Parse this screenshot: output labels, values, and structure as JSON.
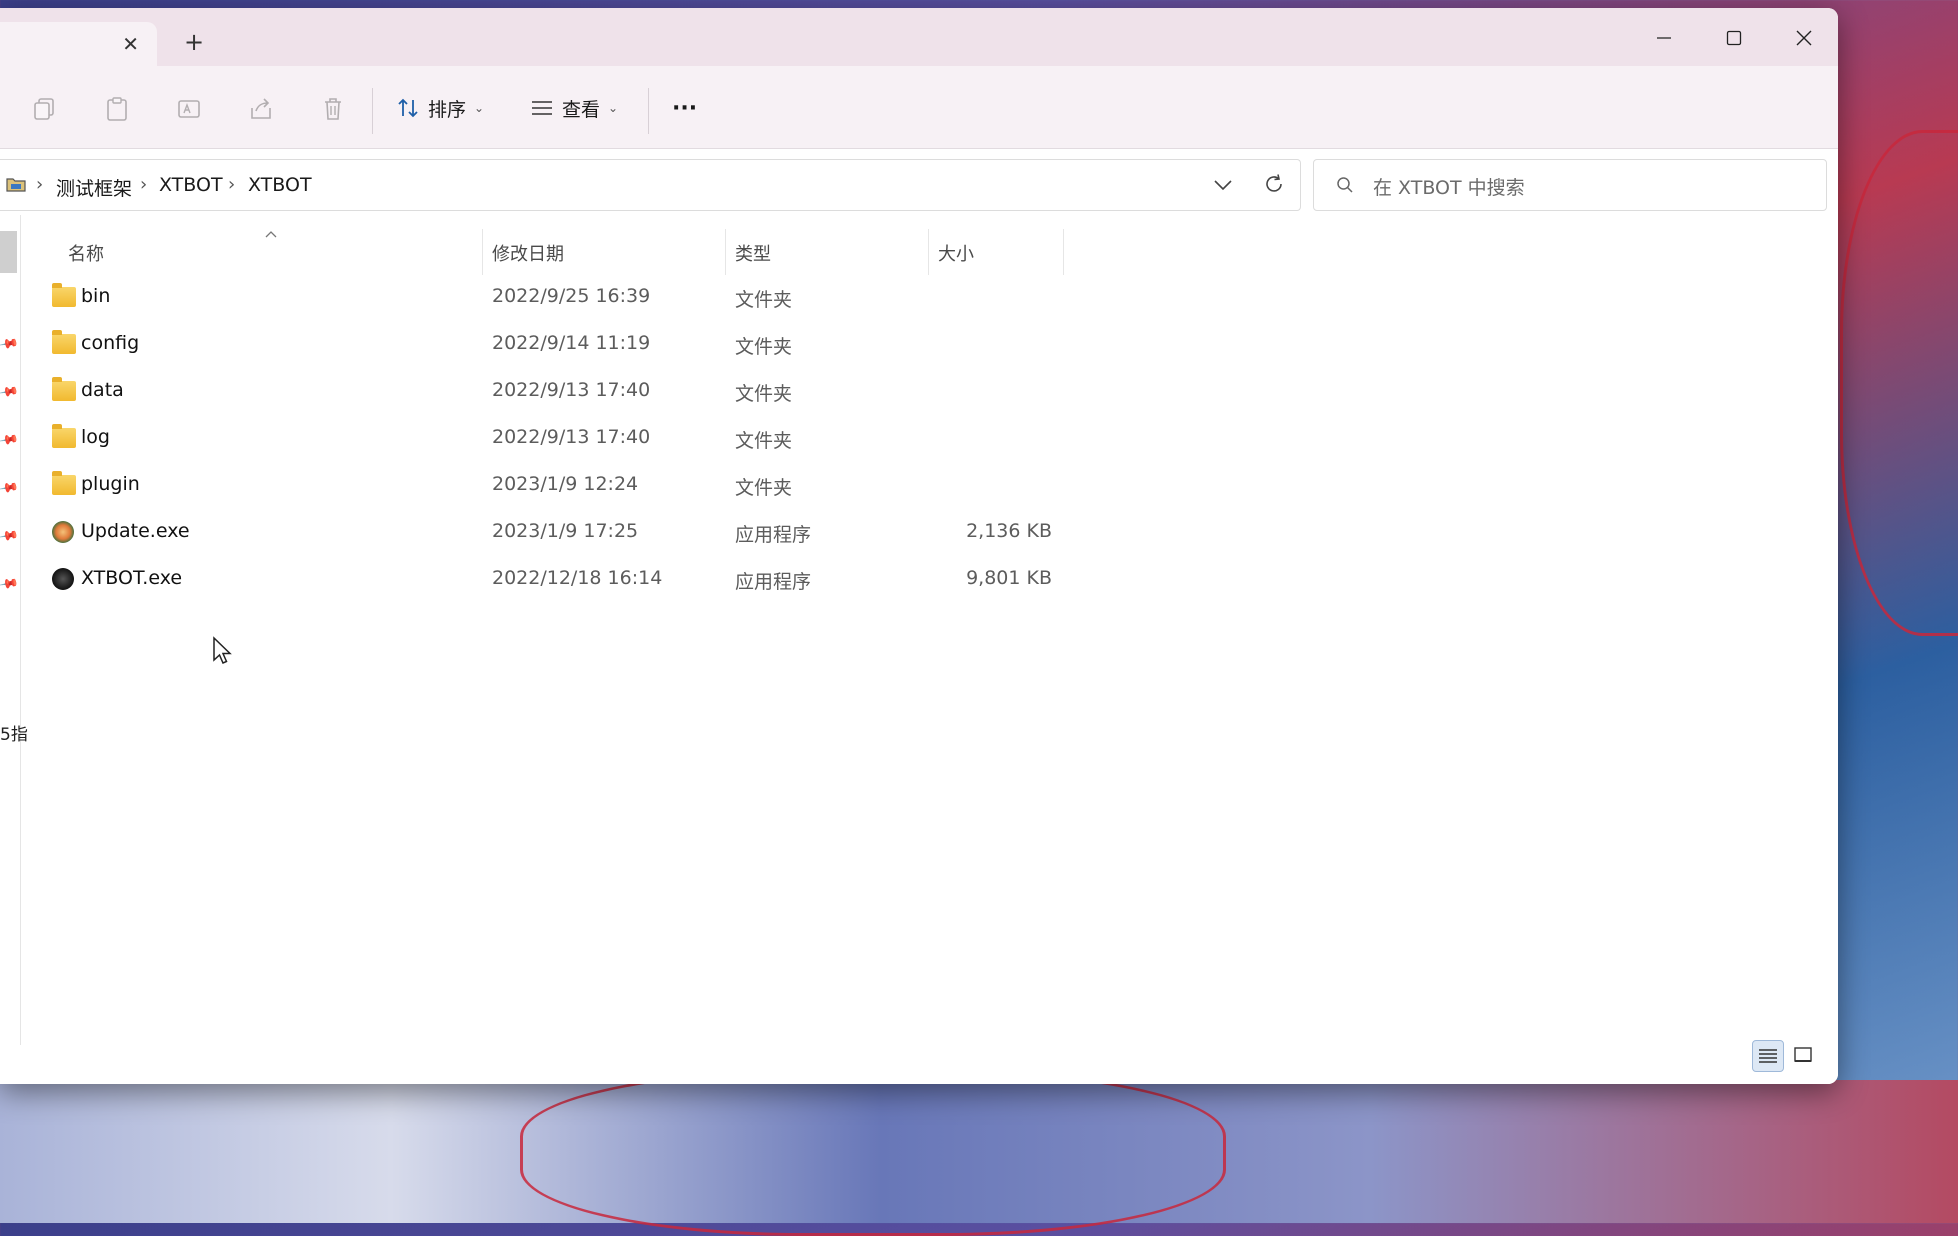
{
  "window": {
    "tab_close_glyph": "✕",
    "new_tab_glyph": "+"
  },
  "toolbar": {
    "sort_label": "排序",
    "view_label": "查看",
    "more_glyph": "···"
  },
  "breadcrumb": {
    "items": [
      "测试框架",
      "XTBOT",
      "XTBOT"
    ],
    "separator": "›"
  },
  "search": {
    "placeholder": "在 XTBOT 中搜索"
  },
  "columns": {
    "name": "名称",
    "date": "修改日期",
    "type": "类型",
    "size": "大小"
  },
  "files": [
    {
      "name": "bin",
      "date": "2022/9/25 16:39",
      "type": "文件夹",
      "size": "",
      "icon": "folder-icon"
    },
    {
      "name": "config",
      "date": "2022/9/14 11:19",
      "type": "文件夹",
      "size": "",
      "icon": "folder-icon"
    },
    {
      "name": "data",
      "date": "2022/9/13 17:40",
      "type": "文件夹",
      "size": "",
      "icon": "folder-icon"
    },
    {
      "name": "log",
      "date": "2022/9/13 17:40",
      "type": "文件夹",
      "size": "",
      "icon": "folder-icon"
    },
    {
      "name": "plugin",
      "date": "2023/1/9 12:24",
      "type": "文件夹",
      "size": "",
      "icon": "folder-icon"
    },
    {
      "name": "Update.exe",
      "date": "2023/1/9 17:25",
      "type": "应用程序",
      "size": "2,136 KB",
      "icon": "update-app-icon"
    },
    {
      "name": "XTBOT.exe",
      "date": "2022/12/18 16:14",
      "type": "应用程序",
      "size": "9,801 KB",
      "icon": "xtbot-app-icon"
    }
  ],
  "sidebar_fragment_text": "5指",
  "colors": {
    "titlebar": "#efe2ea",
    "toolbar": "#f7f1f5",
    "folder": "#f1b92f",
    "selected_view": "#dde8f5"
  }
}
